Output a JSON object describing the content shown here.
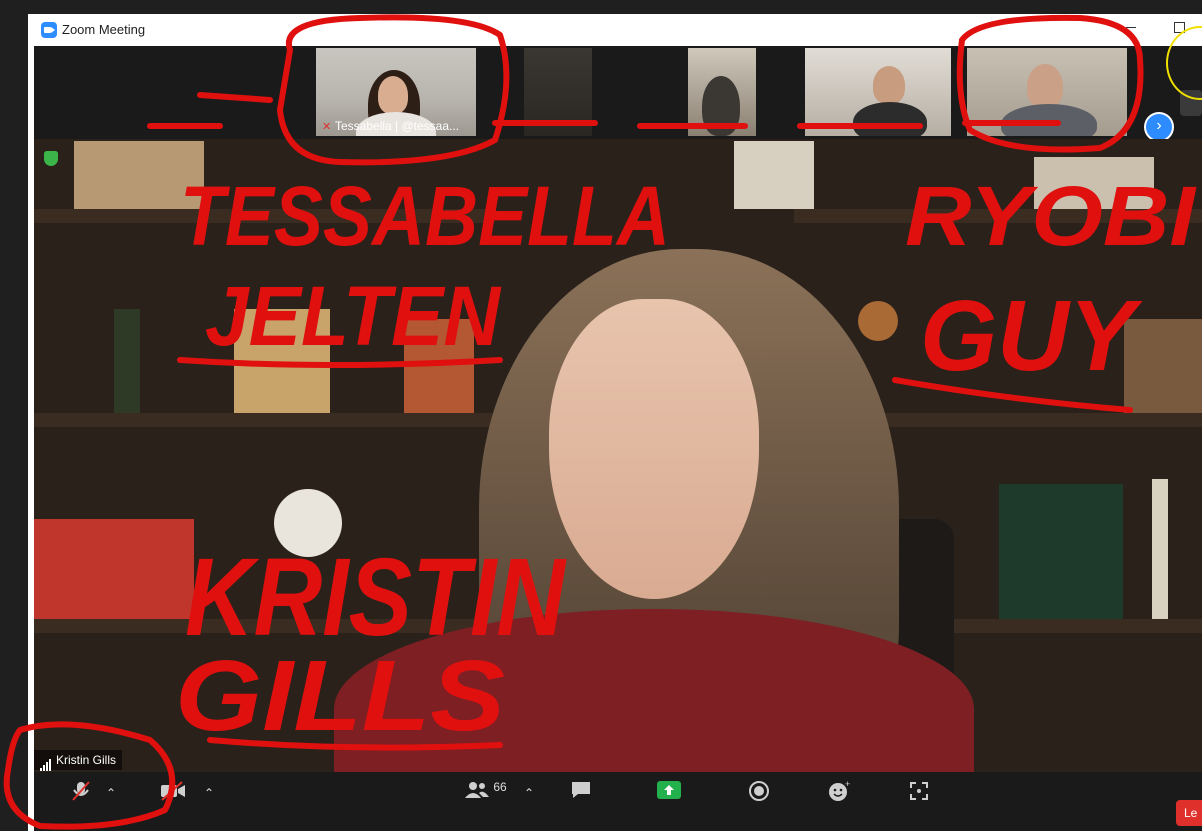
{
  "window": {
    "title": "Zoom Meeting"
  },
  "thumbnails": [
    {
      "name": "Tessabella | @tessaa..."
    },
    {
      "name": ""
    },
    {
      "name": ""
    },
    {
      "name": ""
    },
    {
      "name": ""
    }
  ],
  "speaker": {
    "name": "Kristin Gills"
  },
  "toolbar": {
    "participants_count": "66",
    "leave_label": "Le"
  },
  "annotations": {
    "tessabella_line1": "TESSABELLA",
    "tessabella_line2": "JELTEN",
    "ryobi_line1": "RYOBI",
    "ryobi_line2": "GUY",
    "kristin_line1": "KRISTIN",
    "kristin_line2": "GILLS"
  },
  "colors": {
    "accent": "#2d8cff",
    "ink": "#e0100f",
    "leave": "#e0302c",
    "highlight": "#f1e000"
  }
}
